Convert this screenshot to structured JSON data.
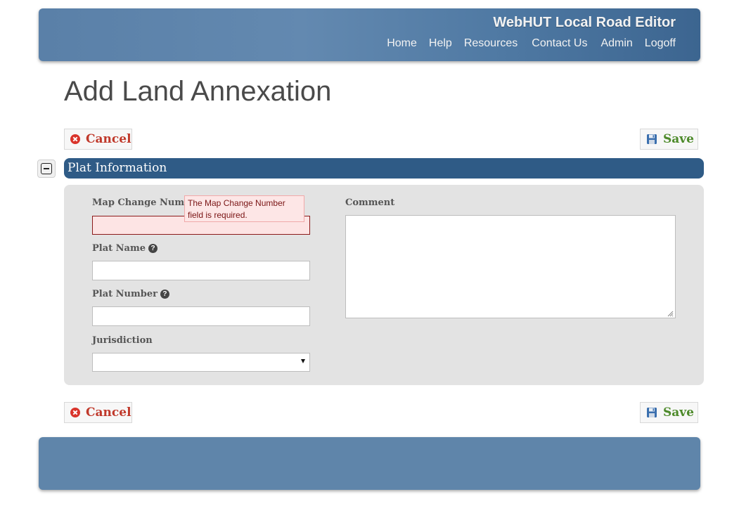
{
  "header": {
    "app_title": "WebHUT Local Road Editor",
    "nav": [
      "Home",
      "Help",
      "Resources",
      "Contact Us",
      "Admin",
      "Logoff"
    ]
  },
  "page_title": "Add Land Annexation",
  "toolbar": {
    "cancel_label": "Cancel",
    "save_label": "Save"
  },
  "section": {
    "title": "Plat Information"
  },
  "form": {
    "map_change_number": {
      "label": "Map Change Number",
      "value": "",
      "error": "The Map Change Number field is required."
    },
    "plat_name": {
      "label": "Plat Name",
      "value": ""
    },
    "plat_number": {
      "label": "Plat Number",
      "value": ""
    },
    "jurisdiction": {
      "label": "Jurisdiction",
      "selected": ""
    },
    "comment": {
      "label": "Comment",
      "value": ""
    }
  },
  "colors": {
    "header_blue": "#5a80a8",
    "section_blue": "#2f5b86",
    "cancel_red": "#c0392b",
    "save_green": "#4d8a2a",
    "error_pink": "#fde4e4"
  },
  "icons": {
    "cancel": "x-circle-icon",
    "save": "floppy-disk-icon",
    "help": "question-circle-icon",
    "collapse": "minus-square-icon"
  }
}
